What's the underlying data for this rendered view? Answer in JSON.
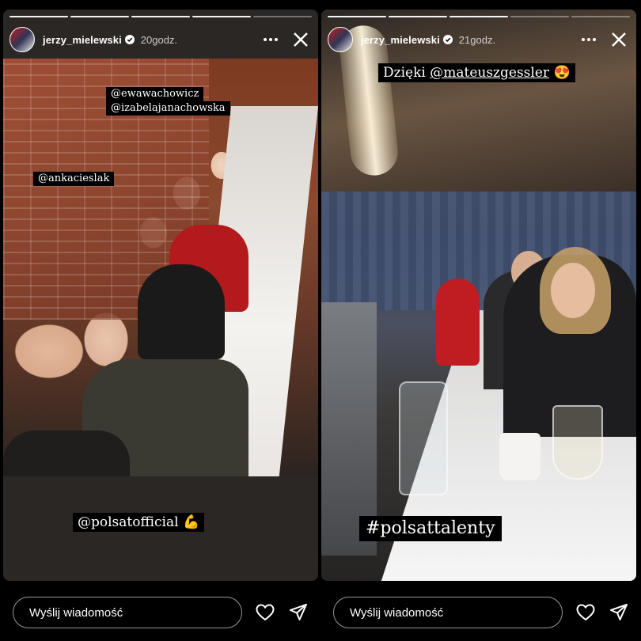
{
  "stories": [
    {
      "username": "jerzy_mielewski",
      "time": "20godz.",
      "mentions": [
        "@ewawachowicz",
        "@izabelajanachowska",
        "@ankacieslak"
      ],
      "caption": "@polsatofficial",
      "caption_emoji": "💪"
    },
    {
      "username": "jerzy_mielewski",
      "time": "21godz.",
      "caption_prefix": "Dzięki",
      "caption_mention": "@mateuszgessler",
      "caption_emoji": "😍",
      "hashtag": "#polsattalenty"
    }
  ],
  "reply": {
    "placeholder": "Wyślij wiadomość"
  },
  "icons": [
    "avatar",
    "verified-icon",
    "more-icon",
    "close-icon",
    "heart-icon",
    "send-icon"
  ],
  "colors": {
    "background": "#000000",
    "verified": "#3897f0"
  }
}
